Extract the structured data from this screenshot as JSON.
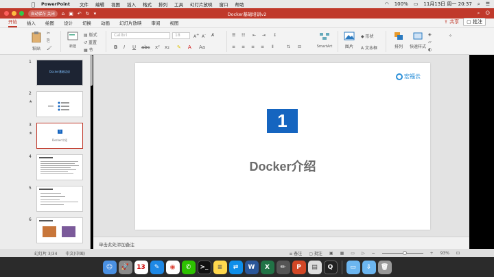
{
  "menubar": {
    "app_name": "PowerPoint",
    "items": [
      "文件",
      "编辑",
      "视图",
      "插入",
      "格式",
      "排列",
      "工具",
      "幻灯片放映",
      "窗口",
      "帮助"
    ],
    "battery": "100%",
    "datetime": "11月13日 周一  20:37"
  },
  "titlebar": {
    "autosave": "自动保存",
    "autosave_state": "关闭",
    "title": "Docker基础培训v2"
  },
  "tabs": [
    "开始",
    "插入",
    "绘图",
    "设计",
    "切换",
    "动画",
    "幻灯片放映",
    "审阅",
    "视图"
  ],
  "active_tab": "开始",
  "share": {
    "share_label": "共享",
    "comment_label": "批注"
  },
  "ribbon": {
    "paste": "粘贴",
    "new_slide": "新建\n幻灯片",
    "layout": "版式",
    "reset": "重置",
    "section": "节",
    "font_name": "Calibri",
    "font_size": "18",
    "convert_smartart": "转换为\nSmartArt",
    "picture": "图片",
    "shapes": "形状",
    "textbox": "文本框",
    "arrange": "排列",
    "quick_styles": "快速样式"
  },
  "slides": [
    {
      "num": "1",
      "title": "Docker基础培训"
    },
    {
      "num": "2",
      "star": "★"
    },
    {
      "num": "3",
      "star": "★",
      "box": "1",
      "title": "Docker介绍"
    },
    {
      "num": "4"
    },
    {
      "num": "5"
    },
    {
      "num": "6"
    }
  ],
  "current_slide": {
    "number": "1",
    "title": "Docker介绍",
    "logo_text": "宏福云"
  },
  "notes_placeholder": "单击此处添加备注",
  "statusbar": {
    "slide_count": "幻灯片 3/34",
    "language": "中文(中国)",
    "notes_btn": "备注",
    "comments_btn": "批注",
    "zoom": "93%"
  },
  "colors": {
    "titlebar": "#c0392b",
    "slide_number_box": "#1565c0",
    "slide_title": "#6b6b6b",
    "accent": "#c0392b"
  },
  "dock": [
    "finder-icon",
    "launchpad-icon",
    "calendar-icon",
    "xcode-icon",
    "chrome-icon",
    "wechat-icon",
    "terminal-icon",
    "notes-icon",
    "teamviewer-icon",
    "word-icon",
    "excel-icon",
    "pencil-icon",
    "powerpoint-icon",
    "preview-icon",
    "quicktime-icon",
    "folder-icon",
    "downloads-icon",
    "trash-icon"
  ]
}
